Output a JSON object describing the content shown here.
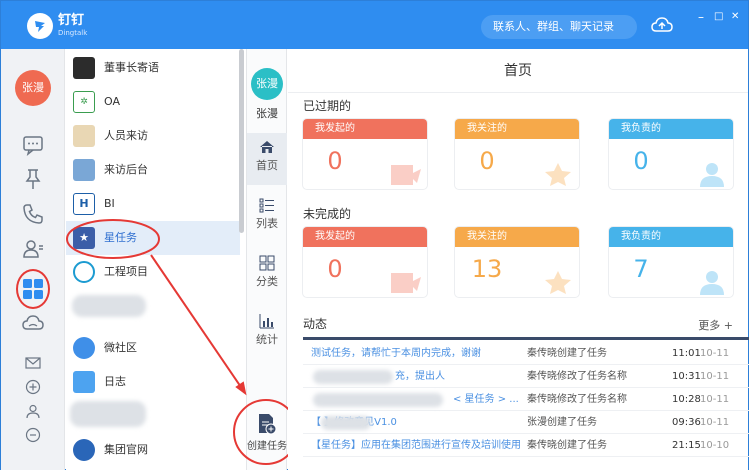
{
  "window": {
    "logo_text": "钉钉",
    "logo_sub": "Dingtalk",
    "search_placeholder": "联系人、群组、聊天记录",
    "controls": [
      "–",
      "□",
      "✕"
    ]
  },
  "rail": {
    "user_avatar": "张漫",
    "icons": [
      "chat-icon",
      "pin-icon",
      "phone-icon",
      "contacts-icon",
      "workbench-icon",
      "cloud-icon",
      "mail-icon",
      "plus-icon",
      "person-icon",
      "more-icon"
    ]
  },
  "apps": [
    {
      "label": "董事长寄语",
      "color": "#2c2c2c"
    },
    {
      "label": "OA",
      "color": "#3a9d4f"
    },
    {
      "label": "人员来访",
      "color": "#e9d7b4"
    },
    {
      "label": "来访后台",
      "color": "#7aa7d6"
    },
    {
      "label": "BI",
      "color": "#1d5fa8"
    },
    {
      "label": "星任务",
      "color": "#3b5ea8"
    },
    {
      "label": "工程项目",
      "color": "#1c9bd1"
    },
    {
      "label": "",
      "color": "#dde1e6"
    },
    {
      "label": "微社区",
      "color": "#3f8fe8"
    },
    {
      "label": "日志",
      "color": "#4da3f0"
    },
    {
      "label": "",
      "color": "#dde1e6"
    },
    {
      "label": "集团官网",
      "color": "#2a66b8"
    }
  ],
  "modules": {
    "user_avatar": "张漫",
    "user_name": "张漫",
    "items": [
      {
        "label": "首页"
      },
      {
        "label": "列表"
      },
      {
        "label": "分类"
      },
      {
        "label": "统计"
      }
    ],
    "create_label": "创建任务"
  },
  "main": {
    "title": "首页",
    "overdue_title": "已过期的",
    "unfinished_title": "未完成的",
    "overdue": [
      {
        "label": "我发起的",
        "value": "0"
      },
      {
        "label": "我关注的",
        "value": "0"
      },
      {
        "label": "我负责的",
        "value": "0"
      }
    ],
    "unfinished": [
      {
        "label": "我发起的",
        "value": "0"
      },
      {
        "label": "我关注的",
        "value": "13"
      },
      {
        "label": "我负责的",
        "value": "7"
      }
    ],
    "feed_title": "动态",
    "more_label": "更多 +",
    "feed": [
      {
        "text": "测试任务，请帮忙于本周内完成，谢谢",
        "action": "秦传晓创建了任务",
        "time": "11:01",
        "date": "10-11"
      },
      {
        "text": "充，提出人",
        "action": "秦传晓修改了任务名称",
        "time": "10:31",
        "date": "10-11"
      },
      {
        "text": "< 星任务 > ...",
        "action": "秦传晓修改了任务名称",
        "time": "10:28",
        "date": "10-11"
      },
      {
        "text": "【 】修改意见V1.0",
        "action": "张漫创建了任务",
        "time": "09:36",
        "date": "10-11"
      },
      {
        "text": "【星任务】应用在集团范围进行宣传及培训使用",
        "action": "秦传晓创建了任务",
        "time": "21:15",
        "date": "10-10"
      }
    ]
  },
  "colors": {
    "brand": "#2f8df0",
    "red": "#f0725d",
    "orange": "#f6a94a",
    "blue": "#46b3ea",
    "annotation": "#e53935"
  }
}
